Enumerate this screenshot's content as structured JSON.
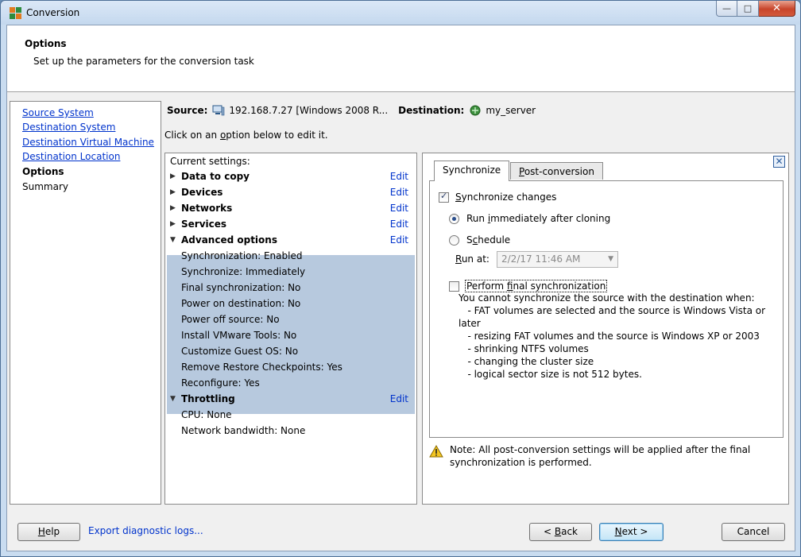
{
  "window": {
    "title": "Conversion",
    "controls": {
      "minimize": "—",
      "maximize": "□",
      "close": "✕"
    }
  },
  "header": {
    "title": "Options",
    "subtitle": "Set up the parameters for the conversion task"
  },
  "nav": {
    "items": [
      {
        "label": "Source System",
        "state": "link"
      },
      {
        "label": "Destination System",
        "state": "link"
      },
      {
        "label": "Destination Virtual Machine",
        "state": "link"
      },
      {
        "label": "Destination Location",
        "state": "link"
      },
      {
        "label": "Options",
        "state": "current"
      },
      {
        "label": "Summary",
        "state": "plain"
      }
    ]
  },
  "summary": {
    "source_label": "Source:",
    "source_value": "192.168.7.27 [Windows 2008 R...",
    "destination_label": "Destination:",
    "destination_value": "my_server",
    "hint_pre": "Click on an ",
    "hint_underlined": "o",
    "hint_post": "ption below to edit it."
  },
  "settings": {
    "header": "Current settings:",
    "edit_label": "Edit",
    "groups": {
      "data_to_copy": "Data to copy",
      "devices": "Devices",
      "networks": "Networks",
      "services": "Services",
      "advanced": "Advanced options",
      "throttling": "Throttling"
    },
    "advanced_items": [
      "Synchronization: Enabled",
      "Synchronize: Immediately",
      "Final synchronization: No",
      "Power on destination: No",
      "Power off source: No",
      "Install VMware Tools: No",
      "Customize Guest OS: No",
      "Remove Restore Checkpoints: Yes",
      "Reconfigure: Yes"
    ],
    "throttling_items": [
      "CPU: None",
      "Network bandwidth: None"
    ]
  },
  "options_panel": {
    "tabs": {
      "synchronize": "Synchronize",
      "post_u": "P",
      "post_rest": "ost-conversion"
    },
    "sync_changes_u": "S",
    "sync_changes_rest": "ynchronize changes",
    "run_immediately_pre": "Run ",
    "run_immediately_u": "i",
    "run_immediately_post": "mmediately after cloning",
    "schedule_pre": "S",
    "schedule_u": "c",
    "schedule_post": "hedule",
    "run_at_u": "R",
    "run_at_rest": "un at:",
    "run_at_value": "2/2/17 11:46 AM",
    "final_sync_pre": "Perform ",
    "final_sync_u": "f",
    "final_sync_post": "inal synchronization",
    "info_lines": [
      "You cannot synchronize the source with the destination when:",
      "   - FAT volumes are selected and the source is Windows Vista or",
      "later",
      "   - resizing FAT volumes and the source is Windows XP or 2003",
      "   - shrinking NTFS volumes",
      "   - changing the cluster size",
      "   - logical sector size is not 512 bytes."
    ],
    "note": "Note: All post-conversion settings will be applied after the final synchronization is performed."
  },
  "footer": {
    "help_u": "H",
    "help_rest": "elp",
    "export_link": "Export diagnostic logs...",
    "back_pre": "< ",
    "back_u": "B",
    "back_post": "ack",
    "next_u": "N",
    "next_post": "ext >",
    "cancel": "Cancel"
  }
}
